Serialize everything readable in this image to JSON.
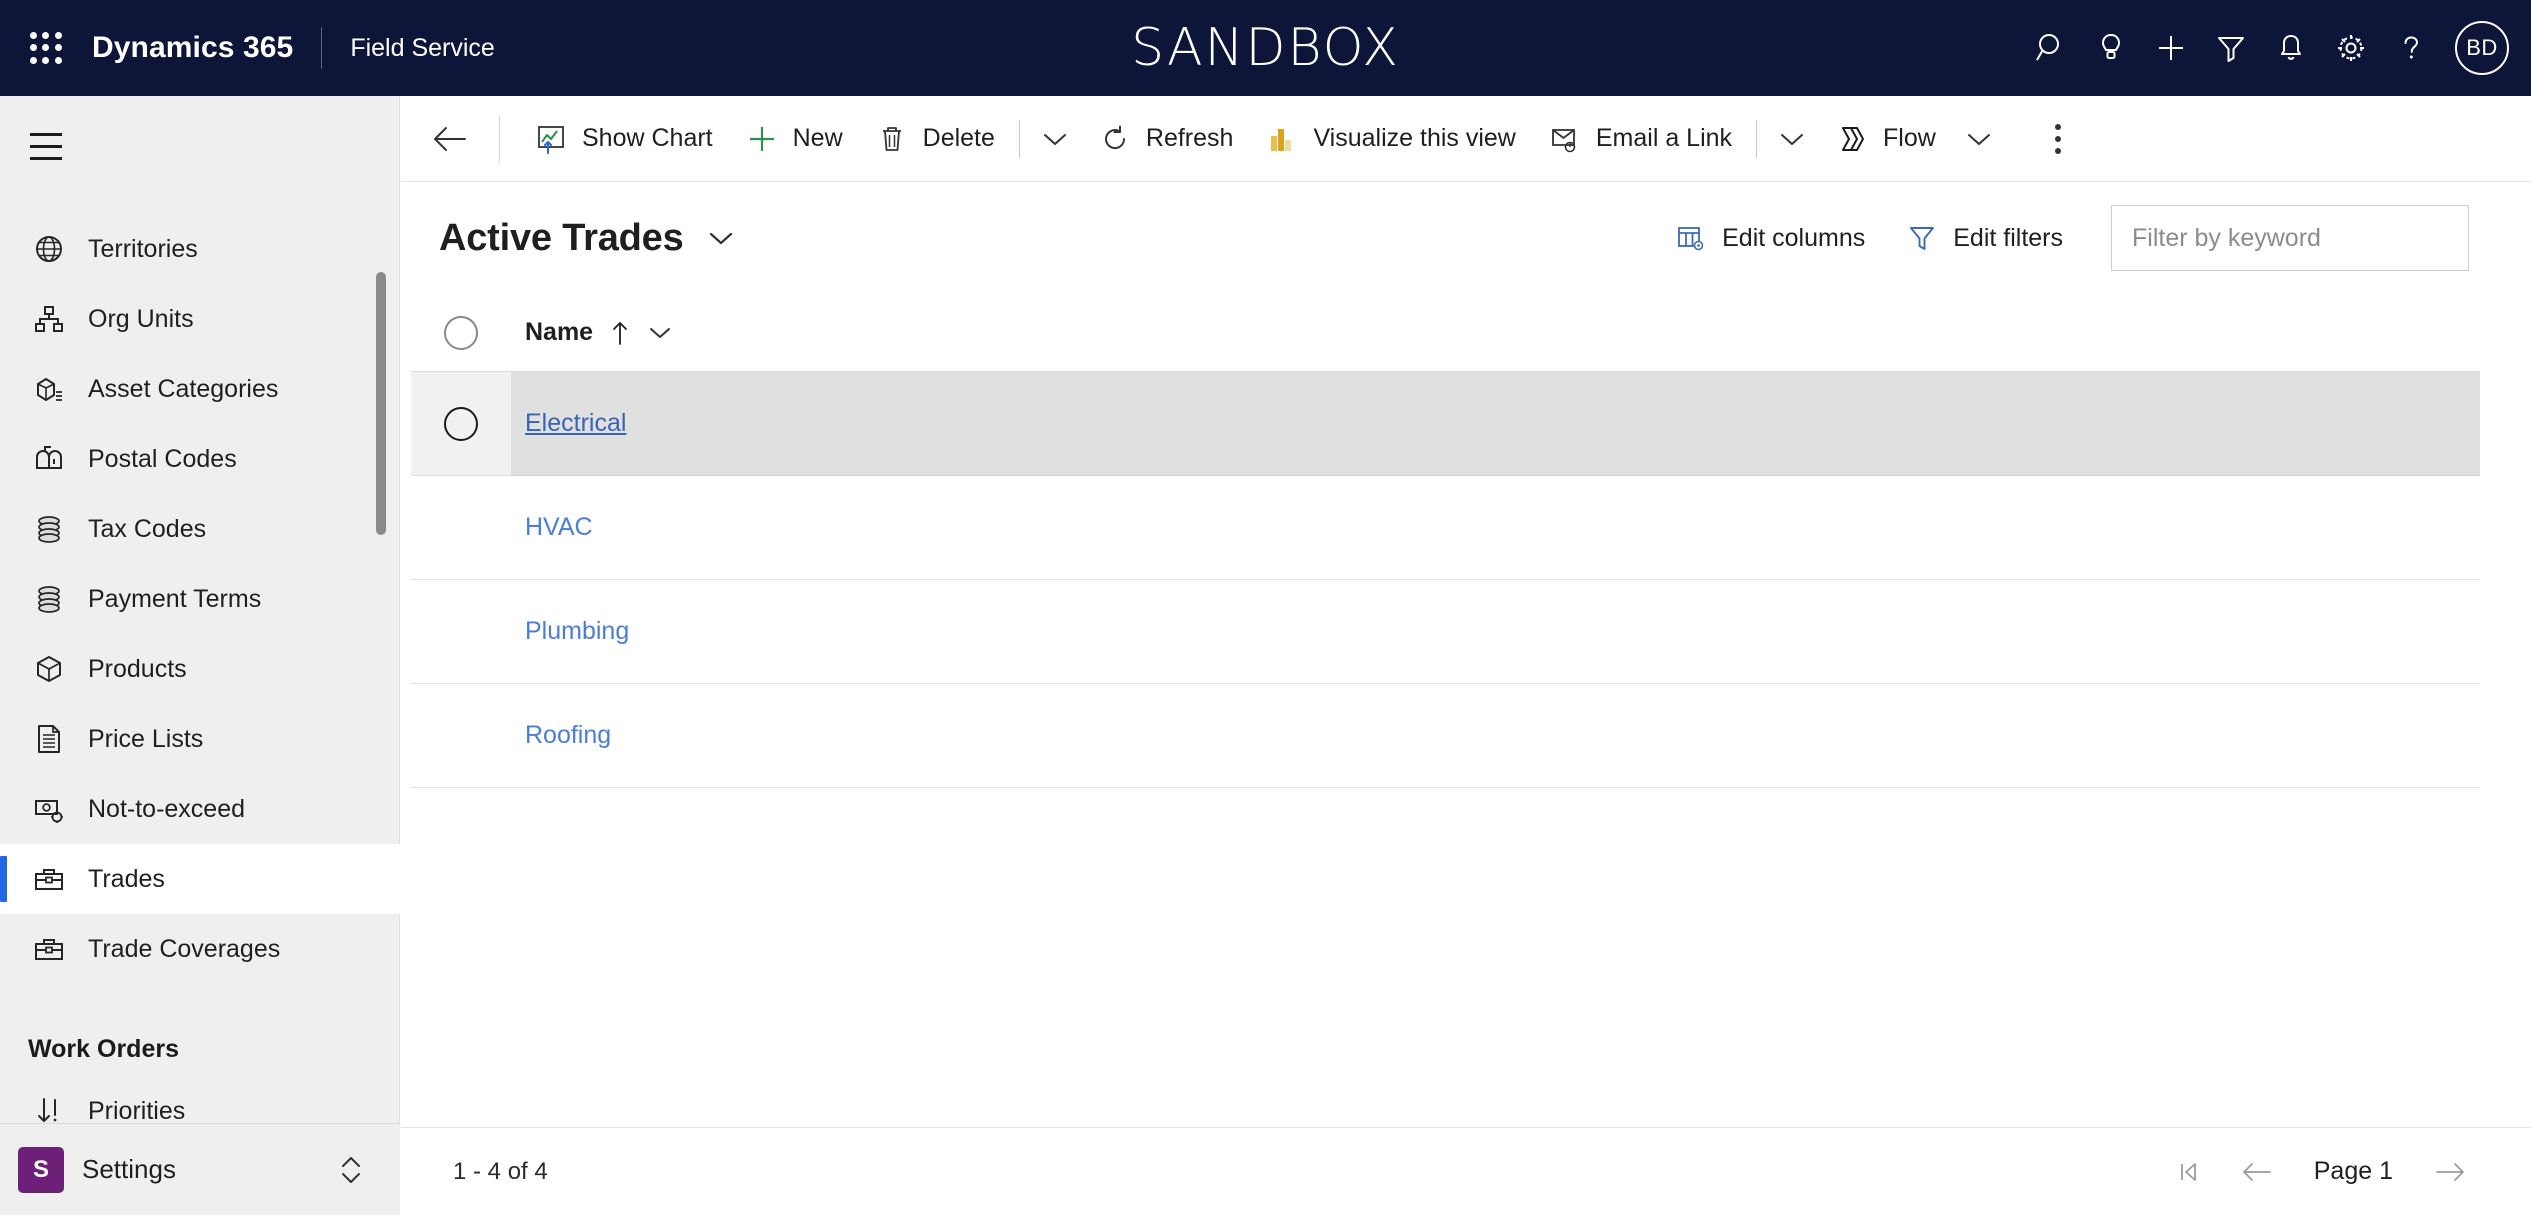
{
  "header": {
    "waffle_icon": "app-launcher-icon",
    "brand": "Dynamics 365",
    "app_name": "Field Service",
    "environment_banner": "SANDBOX",
    "actions": [
      {
        "name": "search-icon",
        "label": "Search"
      },
      {
        "name": "lightbulb-icon",
        "label": "Insights"
      },
      {
        "name": "plus-icon",
        "label": "Quick create"
      },
      {
        "name": "filter-icon",
        "label": "Filter"
      },
      {
        "name": "bell-icon",
        "label": "Notifications"
      },
      {
        "name": "gear-icon",
        "label": "Settings"
      },
      {
        "name": "question-icon",
        "label": "Help"
      }
    ],
    "avatar_initials": "BD"
  },
  "sidebar": {
    "hamburger_icon": "hamburger-icon",
    "items": [
      {
        "label": "Territories",
        "icon": "globe-icon",
        "selected": false
      },
      {
        "label": "Org Units",
        "icon": "org-chart-icon",
        "selected": false
      },
      {
        "label": "Asset Categories",
        "icon": "asset-category-icon",
        "selected": false
      },
      {
        "label": "Postal Codes",
        "icon": "mailbox-icon",
        "selected": false
      },
      {
        "label": "Tax Codes",
        "icon": "coins-icon",
        "selected": false
      },
      {
        "label": "Payment Terms",
        "icon": "coins-icon",
        "selected": false
      },
      {
        "label": "Products",
        "icon": "box-icon",
        "selected": false
      },
      {
        "label": "Price Lists",
        "icon": "document-list-icon",
        "selected": false
      },
      {
        "label": "Not-to-exceed",
        "icon": "money-gear-icon",
        "selected": false
      },
      {
        "label": "Trades",
        "icon": "toolbox-icon",
        "selected": true
      },
      {
        "label": "Trade Coverages",
        "icon": "toolbox-icon",
        "selected": false
      }
    ],
    "group_label": "Work Orders",
    "group_items": [
      {
        "label": "Priorities",
        "icon": "sort-priority-icon",
        "selected": false
      }
    ],
    "settings": {
      "badge": "S",
      "label": "Settings",
      "chevrons_icon": "chevron-up-down-icon",
      "badge_color": "#6d2077"
    }
  },
  "commandbar": {
    "back_icon": "back-arrow-icon",
    "buttons": [
      {
        "label": "Show Chart",
        "icon": "show-chart-icon"
      },
      {
        "label": "New",
        "icon": "plus-icon"
      },
      {
        "label": "Delete",
        "icon": "trash-icon"
      }
    ],
    "delete_caret_icon": "chevron-down-icon",
    "buttons2": [
      {
        "label": "Refresh",
        "icon": "refresh-icon"
      },
      {
        "label": "Visualize this view",
        "icon": "bar-chart-icon"
      },
      {
        "label": "Email a Link",
        "icon": "email-link-icon"
      }
    ],
    "email_caret_icon": "chevron-down-icon",
    "flow": {
      "label": "Flow",
      "icon": "flow-icon",
      "caret_icon": "chevron-down-icon"
    },
    "overflow_icon": "more-vertical-icon"
  },
  "view": {
    "title": "Active Trades",
    "title_caret_icon": "chevron-down-icon",
    "edit_columns": {
      "label": "Edit columns",
      "icon": "edit-columns-icon"
    },
    "edit_filters": {
      "label": "Edit filters",
      "icon": "funnel-icon"
    },
    "search": {
      "value": "",
      "placeholder": "Filter by keyword",
      "icon": "search-icon"
    }
  },
  "grid": {
    "select_all_icon": "select-all-circle-icon",
    "columns": [
      {
        "label": "Name",
        "sort": "ascending",
        "sort_icon": "arrow-up-icon",
        "caret_icon": "chevron-down-icon"
      }
    ],
    "rows": [
      {
        "name": "Electrical",
        "hovered": true
      },
      {
        "name": "HVAC",
        "hovered": false
      },
      {
        "name": "Plumbing",
        "hovered": false
      },
      {
        "name": "Roofing",
        "hovered": false
      }
    ]
  },
  "footer": {
    "record_count": "1 - 4 of 4",
    "first_page_icon": "first-page-icon",
    "prev_page_icon": "prev-page-icon",
    "page_label": "Page 1",
    "next_page_icon": "next-page-icon"
  },
  "colors": {
    "header_bg": "#0d1539",
    "accent": "#2266e3",
    "link": "#4a7ed6",
    "settings_badge": "#6d2077",
    "sidebar_bg": "#efefef"
  }
}
